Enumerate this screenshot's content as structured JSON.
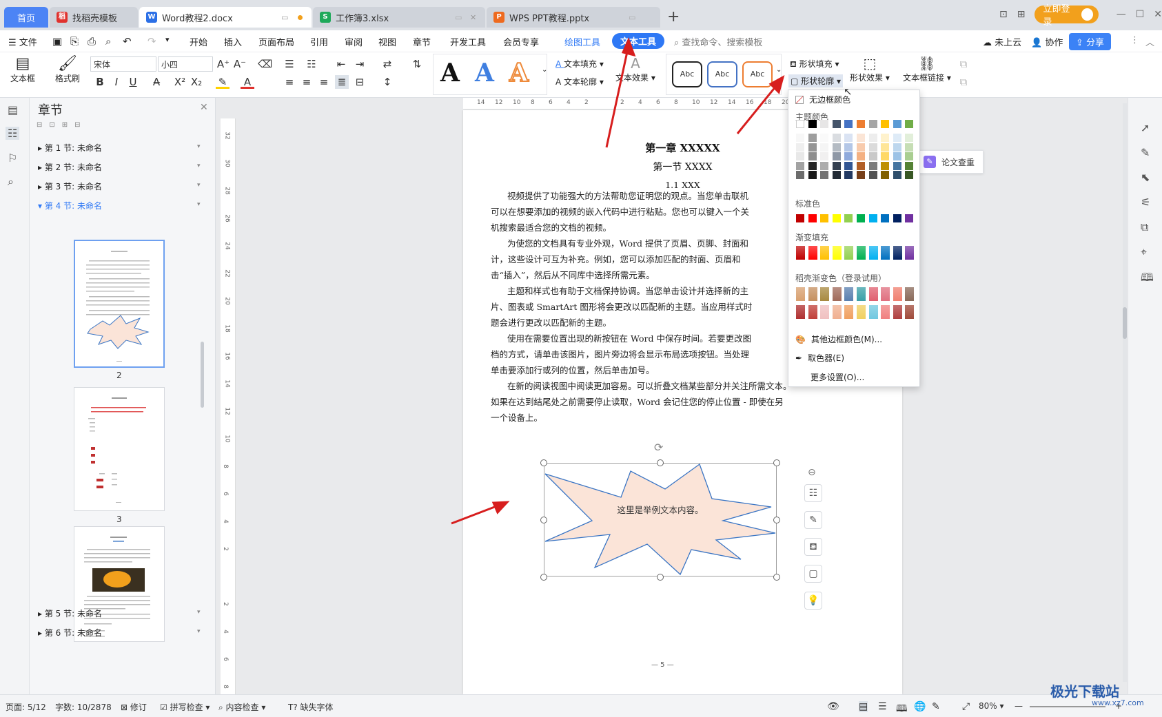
{
  "tabs": {
    "home": "首页",
    "template": "找稻壳模板",
    "word": "Word教程2.docx",
    "excel": "工作簿3.xlsx",
    "ppt": "WPS PPT教程.pptx",
    "add": "+"
  },
  "window": {
    "login": "立即登录"
  },
  "menu": {
    "file": "文件",
    "items": [
      "开始",
      "插入",
      "页面布局",
      "引用",
      "审阅",
      "视图",
      "章节",
      "开发工具",
      "会员专享",
      "绘图工具"
    ],
    "active": "文本工具",
    "search": "查找命令、搜索模板",
    "cloud": "未上云",
    "collab": "协作",
    "share": "分享"
  },
  "ribbon": {
    "textbox": "文本框",
    "format_painter": "格式刷",
    "font_name": "宋体",
    "font_size": "小四",
    "text_fill": "文本填充",
    "text_outline": "文本轮廓",
    "text_effect": "文本效果",
    "style_abc": [
      "Abc",
      "Abc",
      "Abc"
    ],
    "shape_fill": "形状填充",
    "shape_outline": "形状轮廓",
    "shape_effect": "形状效果",
    "textbox_link": "文本框链接"
  },
  "nav": {
    "title": "章节",
    "sections": [
      "第 1 节: 未命名",
      "第 2 节: 未命名",
      "第 3 节: 未命名",
      "第 4 节: 未命名"
    ],
    "sections_after": [
      "第 5 节: 未命名",
      "第 6 节: 未命名"
    ],
    "page_nums": [
      "2",
      "3"
    ]
  },
  "ruler": {
    "h_ticks": [
      "14",
      "12",
      "10",
      "8",
      "6",
      "4",
      "2",
      "",
      "2",
      "4",
      "6",
      "8",
      "10",
      "12",
      "14",
      "16",
      "18",
      "20"
    ],
    "v_ticks": [
      "32",
      "30",
      "28",
      "26",
      "24",
      "22",
      "20",
      "18",
      "16",
      "14",
      "12",
      "10",
      "8",
      "6",
      "4",
      "2",
      "",
      "2",
      "4",
      "6",
      "8"
    ]
  },
  "document": {
    "chapter": "第一章  XXXXX",
    "section": "第一节  XXXX",
    "subsection": "1.1 XXX",
    "lines": [
      "视频提供了功能强大的方法帮助您证明您的观点。当您单击联机",
      "可以在想要添加的视频的嵌入代码中进行粘贴。您也可以键入一个关",
      "机搜索最适合您的文档的视频。",
      "为使您的文档具有专业外观，Word 提供了页眉、页脚、封面和",
      "计，这些设计可互为补充。例如，您可以添加匹配的封面、页眉和",
      "击“插入”，然后从不同库中选择所需元素。",
      "主题和样式也有助于文档保持协调。当您单击设计并选择新的主",
      "片、图表或 SmartArt 图形将会更改以匹配新的主题。当应用样式时",
      "题会进行更改以匹配新的主题。",
      "使用在需要位置出现的新按钮在 Word 中保存时间。若要更改图",
      "档的方式，请单击该图片，图片旁边将会显示布局选项按钮。当处理",
      "单击要添加行或列的位置，然后单击加号。",
      "在新的阅读视图中阅读更加容易。可以折叠文档某些部分并关注所需文本。",
      "如果在达到结尾处之前需要停止读取，Word 会记住您的停止位置 - 即使在另",
      "一个设备上。"
    ],
    "shape_text": "这里是举例文本内容。",
    "page_footer": "— 5 —",
    "side_panel": "论文查重"
  },
  "dropdown": {
    "no_border": "无边框颜色",
    "theme_colors": "主题颜色",
    "standard": "标准色",
    "gradient": "渐变填充",
    "docer_gradient": "稻壳渐变色（登录试用）",
    "more_colors": "其他边框颜色(M)...",
    "eyedropper": "取色器(E)",
    "more_settings": "更多设置(O)...",
    "theme_top": [
      "#ffffff",
      "#000000",
      "#e7e6e6",
      "#44546a",
      "#4472c4",
      "#ed7d31",
      "#a5a5a5",
      "#ffc000",
      "#5b9bd5",
      "#70ad47"
    ],
    "standard_colors": [
      "#c00000",
      "#ff0000",
      "#ffc000",
      "#ffff00",
      "#92d050",
      "#00b050",
      "#00b0f0",
      "#0070c0",
      "#002060",
      "#7030a0"
    ]
  },
  "status": {
    "page": "页面: 5/12",
    "words": "字数: 10/2878",
    "revise": "修订",
    "spell": "拼写检查",
    "content": "内容检查",
    "font_missing": "缺失字体",
    "zoom": "80%"
  },
  "watermark": "极光下载站",
  "watermark_url": "www.xz7.com",
  "colors": {
    "accent": "#2e78f5",
    "login": "#f2a01c",
    "shape_fill": "#fbe4d8",
    "shape_stroke": "#3a75c4"
  }
}
